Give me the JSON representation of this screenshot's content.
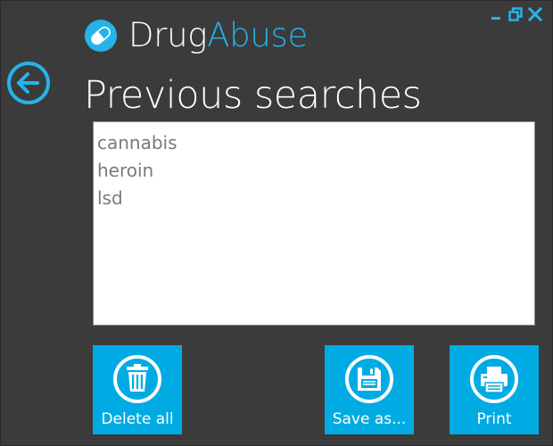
{
  "app": {
    "name_part1": "Drug",
    "name_part2": "Abuse",
    "accent_color": "#25b3ea"
  },
  "window_controls": [
    "minimize-icon",
    "restore-icon",
    "close-icon"
  ],
  "page": {
    "title": "Previous searches"
  },
  "searches": [
    "cannabis",
    "heroin",
    "lsd"
  ],
  "actions": {
    "delete_all": "Delete all",
    "save_as": "Save as...",
    "print": "Print",
    "tile_color": "#00abe4"
  },
  "icons": {
    "back": "back-arrow-icon",
    "app": "pill-icon",
    "delete": "trash-icon",
    "save": "floppy-disk-icon",
    "print": "printer-icon"
  }
}
